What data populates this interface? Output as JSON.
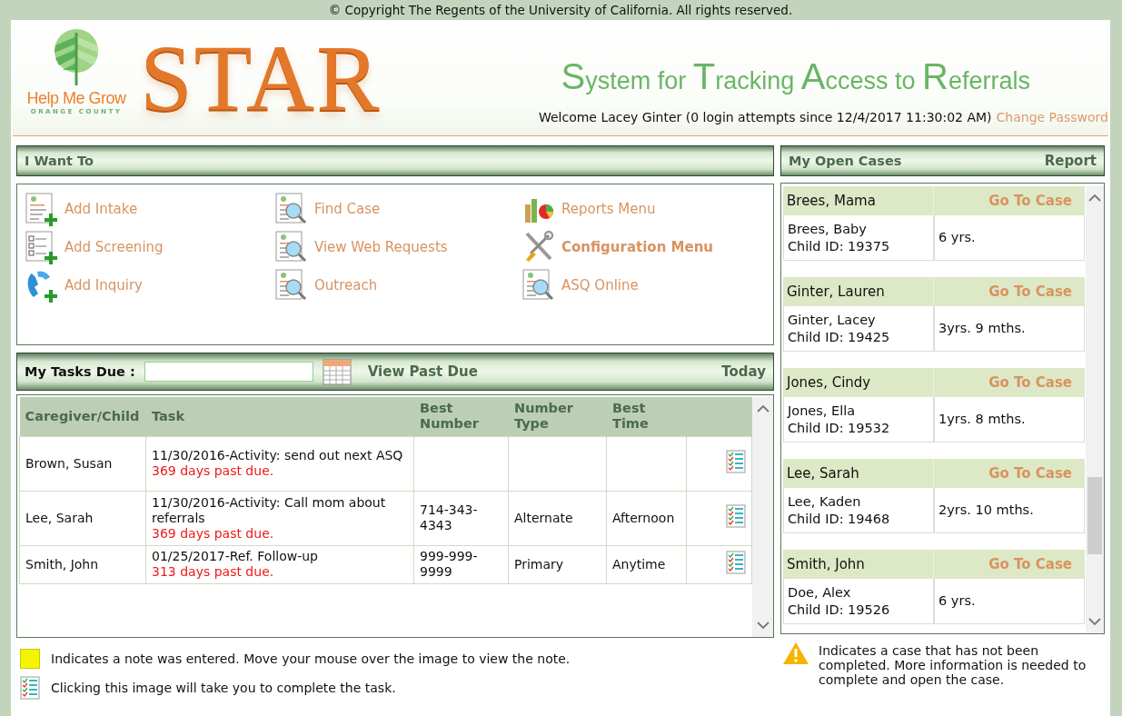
{
  "copyright": "© Copyright The Regents of the University of California. All rights reserved.",
  "header": {
    "org_name": "Help Me Grow",
    "org_region": "ORANGE COUNTY",
    "app_name": "STAR",
    "app_subtitle": "System for Tracking Access to Referrals",
    "welcome": "Welcome Lacey Ginter (0 login attempts since 12/4/2017 11:30:02 AM)",
    "change_password": "Change Password"
  },
  "i_want_to": {
    "title": "I Want To",
    "actions": [
      {
        "label": "Add Intake",
        "kind": "doc-add",
        "bold": false
      },
      {
        "label": "Find Case",
        "kind": "doc-search",
        "bold": false
      },
      {
        "label": "Reports Menu",
        "kind": "chart",
        "bold": false
      },
      {
        "label": "Add Screening",
        "kind": "checklist-add",
        "bold": false
      },
      {
        "label": "View Web Requests",
        "kind": "doc-search",
        "bold": false
      },
      {
        "label": "Configuration Menu",
        "kind": "tools",
        "bold": true
      },
      {
        "label": "Add Inquiry",
        "kind": "phone-add",
        "bold": false
      },
      {
        "label": "Outreach",
        "kind": "doc-search",
        "bold": false
      },
      {
        "label": "ASQ Online",
        "kind": "doc-search",
        "bold": false
      }
    ]
  },
  "tasks": {
    "title": "My Tasks Due :",
    "view_past_due": "View Past Due",
    "today": "Today",
    "columns": [
      "Caregiver/Child",
      "Task",
      "Best Number",
      "Number Type",
      "Best Time"
    ],
    "rows": [
      {
        "caregiver": "Brown, Susan",
        "task": "11/30/2016-Activity: send out next ASQ",
        "overdue": "369 days past due.",
        "best_number": "",
        "number_type": "",
        "best_time": ""
      },
      {
        "caregiver": "Lee, Sarah",
        "task": "11/30/2016-Activity: Call mom about referrals",
        "overdue": "369 days past due.",
        "best_number": "714-343-4343",
        "number_type": "Alternate",
        "best_time": "Afternoon"
      },
      {
        "caregiver": "Smith, John",
        "task": "01/25/2017-Ref. Follow-up",
        "overdue": "313 days past due.",
        "best_number": "999-999-9999",
        "number_type": "Primary",
        "best_time": "Anytime"
      }
    ]
  },
  "open_cases": {
    "title": "My Open Cases",
    "report": "Report",
    "cases": [
      {
        "caregiver": "Brees, Mama",
        "link": "Go To Case",
        "child": "Brees, Baby",
        "child_id": "Child ID: 19375",
        "age": "6 yrs."
      },
      {
        "caregiver": "Ginter, Lauren",
        "link": "Go To Case",
        "child": "Ginter, Lacey",
        "child_id": "Child ID: 19425",
        "age": "3yrs. 9 mths."
      },
      {
        "caregiver": "Jones, Cindy",
        "link": "Go To Case",
        "child": "Jones, Ella",
        "child_id": "Child ID: 19532",
        "age": "1yrs. 8 mths."
      },
      {
        "caregiver": "Lee, Sarah",
        "link": "Go To Case",
        "child": "Lee, Kaden",
        "child_id": "Child ID: 19468",
        "age": "2yrs. 10 mths."
      },
      {
        "caregiver": "Smith, John",
        "link": "Go To Case",
        "child": "Doe, Alex",
        "child_id": "Child ID: 19526",
        "age": "6 yrs."
      }
    ]
  },
  "legend": {
    "note": "Indicates a note was entered. Move your mouse over the image to view the note.",
    "task": "Clicking this image will take you to complete the task.",
    "incomplete": "Indicates a case that has not been completed. More information is needed to complete and open the case."
  }
}
